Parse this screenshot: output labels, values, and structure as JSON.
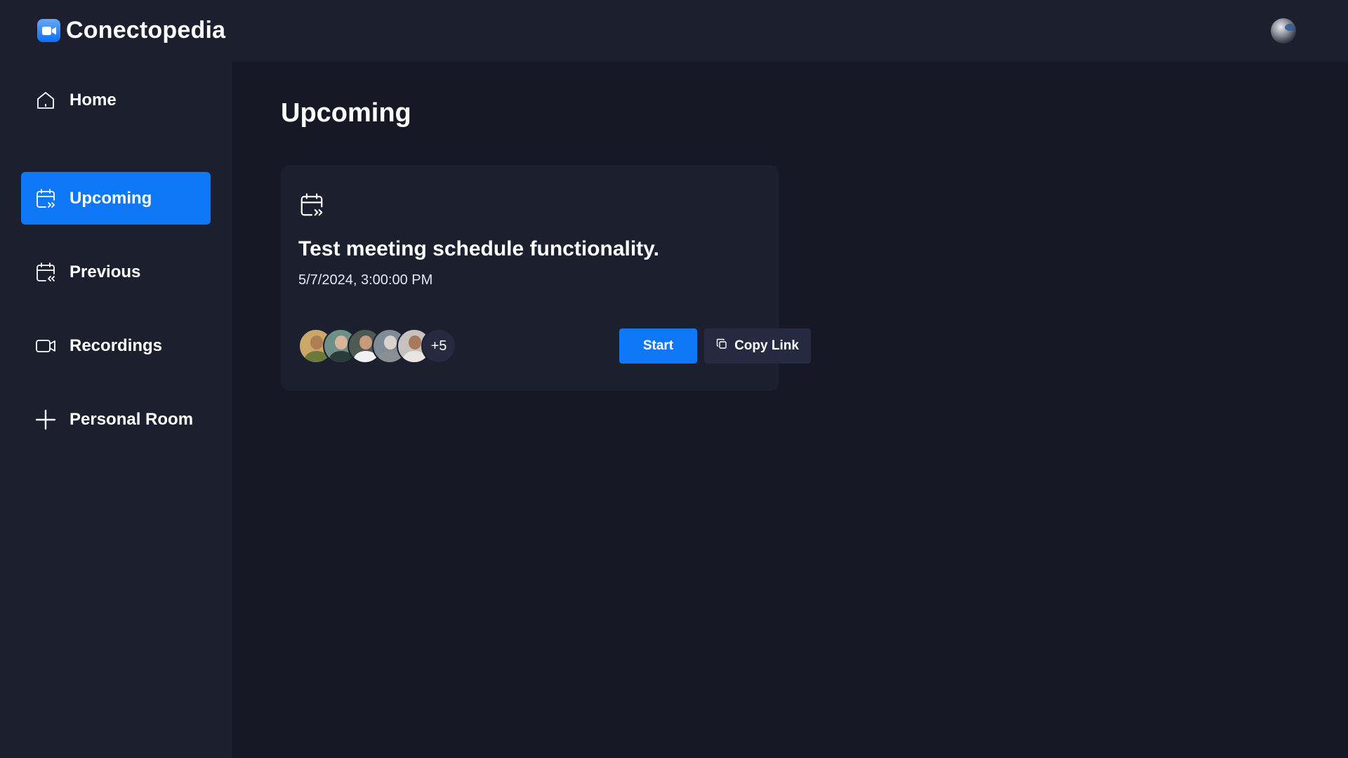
{
  "app": {
    "name": "Conectopedia"
  },
  "sidebar": {
    "items": [
      {
        "label": "Home",
        "icon": "home-icon"
      },
      {
        "label": "Upcoming",
        "icon": "calendar-upcoming-icon",
        "active": true
      },
      {
        "label": "Previous",
        "icon": "calendar-previous-icon"
      },
      {
        "label": "Recordings",
        "icon": "video-icon"
      },
      {
        "label": "Personal Room",
        "icon": "plus-icon"
      }
    ]
  },
  "main": {
    "title": "Upcoming",
    "meetings": [
      {
        "title": "Test meeting schedule functionality.",
        "date": "5/7/2024, 3:00:00 PM",
        "more_attendees": "+5",
        "start_label": "Start",
        "copy_label": "Copy Link"
      }
    ]
  },
  "colors": {
    "accent": "#0e78f9",
    "sidebar_bg": "#1c1f2e",
    "main_bg": "#161925",
    "secondary_button": "#252a41"
  }
}
